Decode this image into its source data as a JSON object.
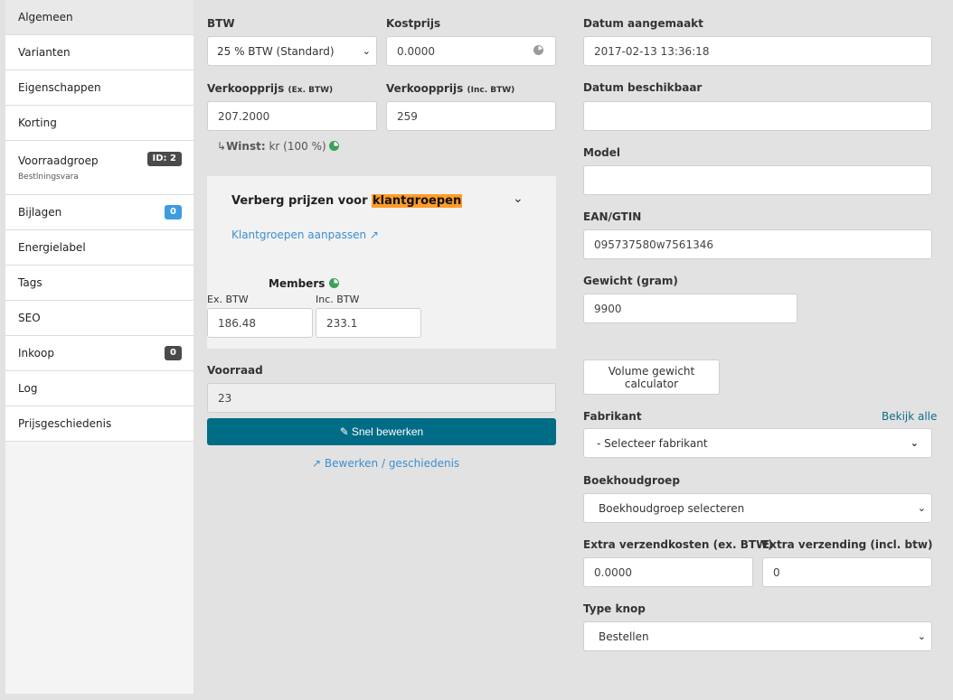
{
  "sidebar": {
    "items": [
      {
        "label": "Algemeen"
      },
      {
        "label": "Varianten"
      },
      {
        "label": "Eigenschappen"
      },
      {
        "label": "Korting"
      },
      {
        "label": "Voorraadgroep",
        "sub": "Bestlningsvara",
        "badge": "ID: 2"
      },
      {
        "label": "Bijlagen",
        "badge": "0"
      },
      {
        "label": "Energielabel"
      },
      {
        "label": "Tags"
      },
      {
        "label": "SEO"
      },
      {
        "label": "Inkoop",
        "badge": "0"
      },
      {
        "label": "Log"
      },
      {
        "label": "Prijsgeschiedenis"
      }
    ]
  },
  "pricing": {
    "btw_label": "BTW",
    "btw_value": "25 % BTW (Standard)",
    "kostprijs_label": "Kostprijs",
    "kostprijs_value": "0.0000",
    "verkoop_ex_label": "Verkoopprijs",
    "verkoop_ex_suffix": "(Ex. BTW)",
    "verkoop_ex_value": "207.2000",
    "verkoop_inc_label": "Verkoopprijs",
    "verkoop_inc_suffix": "(Inc. BTW)",
    "verkoop_inc_value": "259",
    "winst_arrow": "↳",
    "winst_label": "Winst:",
    "winst_value": "kr (100 %)"
  },
  "customer_groups": {
    "title_prefix": "Verberg prijzen voor",
    "title_highlight": "klantgroepen",
    "edit_link": "Klantgroepen aanpassen",
    "group_name": "Members",
    "ex_label": "Ex. BTW",
    "ex_value": "186.48",
    "inc_label": "Inc. BTW",
    "inc_value": "233.1"
  },
  "stock": {
    "label": "Voorraad",
    "value": "23",
    "quick_edit": "Snel bewerken",
    "history_link": "Bewerken / geschiedenis"
  },
  "details": {
    "created_label": "Datum aangemaakt",
    "created_value": "2017-02-13 13:36:18",
    "available_label": "Datum beschikbaar",
    "available_value": "",
    "model_label": "Model",
    "model_value": "",
    "ean_label": "EAN/GTIN",
    "ean_value": "095737580w7561346",
    "weight_label": "Gewicht (gram)",
    "weight_value": "9900",
    "volume_button": "Volume gewicht calculator",
    "manufacturer_label": "Fabrikant",
    "manufacturer_link": "Bekijk alle",
    "manufacturer_value": "- Selecteer fabrikant",
    "accounting_label": "Boekhoudgroep",
    "accounting_value": "Boekhoudgroep selecteren",
    "extra_ship_ex_label": "Extra verzendkosten (ex. BTW)",
    "extra_ship_ex_value": "0.0000",
    "extra_ship_inc_label": "Extra verzending (incl. btw)",
    "extra_ship_inc_value": "0",
    "button_type_label": "Type knop",
    "button_type_value": "Bestellen"
  }
}
